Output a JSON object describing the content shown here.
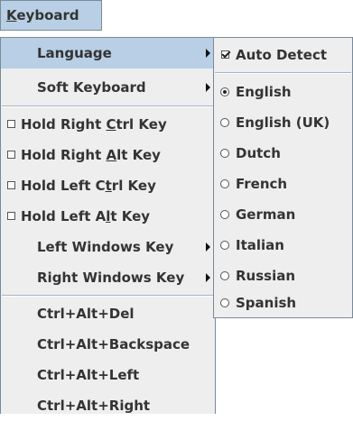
{
  "menubar": {
    "keyboard_pre": "",
    "keyboard_mnemonic": "K",
    "keyboard_post": "eyboard"
  },
  "main_menu": {
    "language": "Language",
    "soft_keyboard": "Soft Keyboard",
    "hold_right_ctrl": {
      "pre": "Hold Right ",
      "mn": "C",
      "post": "trl Key",
      "checked": false
    },
    "hold_right_alt": {
      "pre": "Hold Right ",
      "mn": "A",
      "post": "lt Key",
      "checked": false
    },
    "hold_left_ctrl": {
      "pre": "Hold Left C",
      "mn": "t",
      "post": "rl Key",
      "checked": false
    },
    "hold_left_alt": {
      "pre": "Hold Left A",
      "mn": "l",
      "post": "t Key",
      "checked": false
    },
    "left_windows_key": "Left Windows Key",
    "right_windows_key": "Right Windows Key",
    "ctrl_alt_del": "Ctrl+Alt+Del",
    "ctrl_alt_backspace": "Ctrl+Alt+Backspace",
    "ctrl_alt_left": "Ctrl+Alt+Left",
    "ctrl_alt_right": "Ctrl+Alt+Right"
  },
  "language_menu": {
    "auto_detect": {
      "label": "Auto Detect",
      "checked": true
    },
    "options": [
      {
        "label": "English",
        "selected": true
      },
      {
        "label": "English (UK)",
        "selected": false
      },
      {
        "label": "Dutch",
        "selected": false
      },
      {
        "label": "French",
        "selected": false
      },
      {
        "label": "German",
        "selected": false
      },
      {
        "label": "Italian",
        "selected": false
      },
      {
        "label": "Russian",
        "selected": false
      },
      {
        "label": "Spanish",
        "selected": false
      }
    ]
  }
}
